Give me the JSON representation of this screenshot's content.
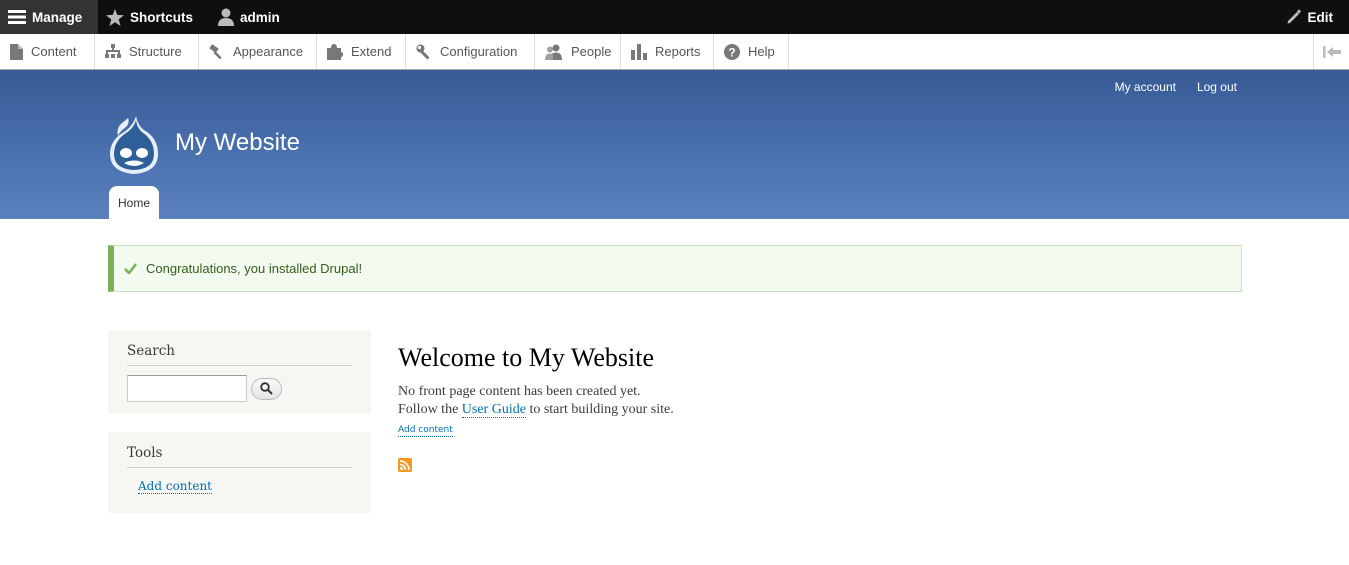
{
  "toolbar": {
    "manage_label": "Manage",
    "shortcuts_label": "Shortcuts",
    "user_label": "admin",
    "edit_label": "Edit"
  },
  "tray": {
    "items": [
      {
        "label": "Content",
        "icon": "document-icon"
      },
      {
        "label": "Structure",
        "icon": "sitemap-icon"
      },
      {
        "label": "Appearance",
        "icon": "paint-icon"
      },
      {
        "label": "Extend",
        "icon": "puzzle-icon"
      },
      {
        "label": "Configuration",
        "icon": "wrench-icon"
      },
      {
        "label": "People",
        "icon": "people-icon"
      },
      {
        "label": "Reports",
        "icon": "bar-chart-icon"
      },
      {
        "label": "Help",
        "icon": "help-icon"
      }
    ]
  },
  "header": {
    "my_account": "My account",
    "log_out": "Log out",
    "site_name": "My Website",
    "tab_home": "Home"
  },
  "message": {
    "text": "Congratulations, you installed Drupal!"
  },
  "sidebar": {
    "search_title": "Search",
    "tools_title": "Tools",
    "tools_link": "Add content"
  },
  "main": {
    "title": "Welcome to My Website",
    "line1": "No front page content has been created yet.",
    "line2_pre": "Follow the ",
    "line2_link": "User Guide",
    "line2_post": " to start building your site.",
    "add_content": "Add content"
  },
  "colors": {
    "toolbar_bg": "#0f0f0f",
    "header_top": "#375a95",
    "header_bottom": "#5a80bd",
    "message_accent": "#77b259",
    "link": "#0071b3",
    "rss": "#f29a1f"
  }
}
